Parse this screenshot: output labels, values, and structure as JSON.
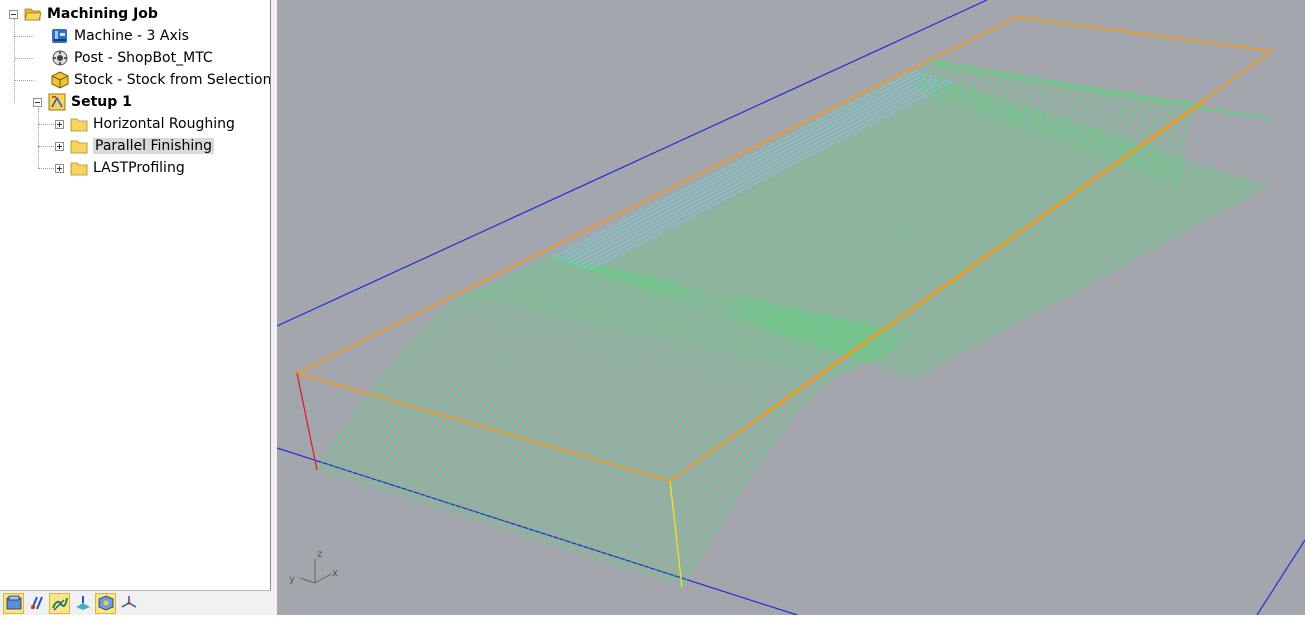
{
  "tree": {
    "root": {
      "label": "Machining Job",
      "icon": "folder-open-icon"
    },
    "items": [
      {
        "label": "Machine - 3 Axis",
        "icon": "machine-icon"
      },
      {
        "label": "Post - ShopBot_MTC",
        "icon": "post-processor-icon"
      },
      {
        "label": "Stock - Stock from Selection",
        "icon": "stock-box-icon"
      }
    ],
    "setup": {
      "label": "Setup 1",
      "icon": "setup-icon"
    },
    "operations": [
      {
        "label": "Horizontal Roughing",
        "icon": "folder-icon",
        "selected": false
      },
      {
        "label": "Parallel Finishing",
        "icon": "folder-icon",
        "selected": true
      },
      {
        "label": "LASTProfiling",
        "icon": "folder-icon",
        "selected": false
      }
    ]
  },
  "toolbar": {
    "buttons": [
      {
        "name": "machining-job-button",
        "icon": "job-icon",
        "active": true
      },
      {
        "name": "tools-button",
        "icon": "tools-icon",
        "active": false
      },
      {
        "name": "toolpath-button",
        "icon": "toolpath-icon",
        "active": true
      },
      {
        "name": "simulation-button",
        "icon": "simulation-icon",
        "active": false
      },
      {
        "name": "stock-button",
        "icon": "stock-icon",
        "active": true
      },
      {
        "name": "axis-button",
        "icon": "axis-icon",
        "active": false
      }
    ]
  },
  "viewport": {
    "axis_labels": {
      "x": "x",
      "y": "y",
      "z": "z"
    },
    "background_color": "#a3a7ad",
    "toolpath_color": "#2df05a",
    "stock_color": "#f39a1a",
    "grid_axis_color": "#1d2fd4"
  }
}
